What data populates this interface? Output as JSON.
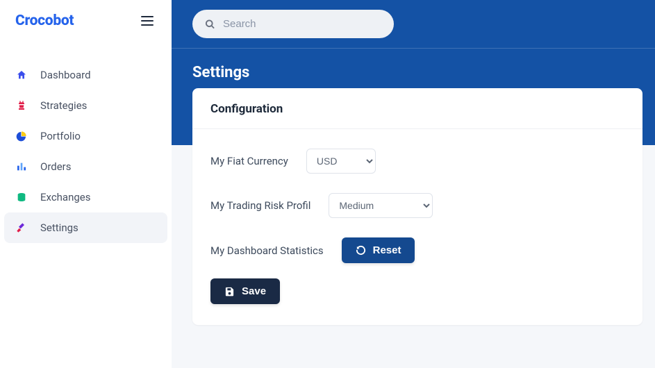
{
  "brand": "Crocobot",
  "search": {
    "placeholder": "Search"
  },
  "nav": {
    "items": [
      {
        "label": "Dashboard"
      },
      {
        "label": "Strategies"
      },
      {
        "label": "Portfolio"
      },
      {
        "label": "Orders"
      },
      {
        "label": "Exchanges"
      },
      {
        "label": "Settings"
      }
    ]
  },
  "page": {
    "title": "Settings"
  },
  "card": {
    "title": "Configuration",
    "fields": {
      "fiat": {
        "label": "My Fiat Currency",
        "selected": "USD"
      },
      "risk": {
        "label": "My Trading Risk Profil",
        "selected": "Medium"
      },
      "stats": {
        "label": "My Dashboard Statistics"
      }
    },
    "buttons": {
      "reset": "Reset",
      "save": "Save"
    }
  }
}
